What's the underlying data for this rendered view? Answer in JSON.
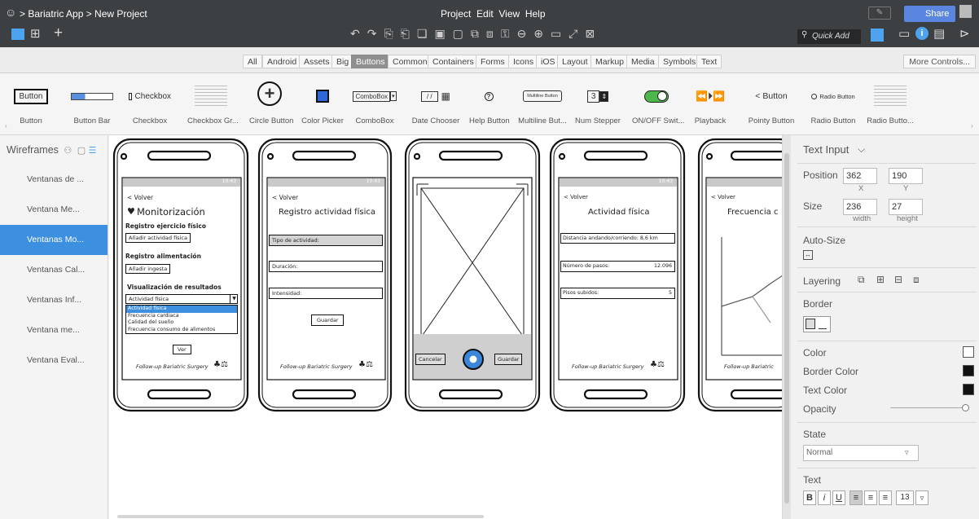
{
  "titlebar": {
    "breadcrumb": "> Bariatric App > New Project",
    "menu": "Project  Edit  View  Help",
    "share": "Share",
    "quick_add": "Quick Add"
  },
  "filters": [
    "All",
    "Android",
    "Assets",
    "Big",
    "Buttons",
    "Common",
    "Containers",
    "Forms",
    "Icons",
    "iOS",
    "Layout",
    "Markup",
    "Media",
    "Symbols",
    "Text"
  ],
  "active_filter": "Buttons",
  "more_controls": "More Controls...",
  "components": [
    {
      "label": "Button",
      "preview": "Button"
    },
    {
      "label": "Button Bar",
      "preview": ""
    },
    {
      "label": "Checkbox",
      "preview": "Checkbox"
    },
    {
      "label": "Checkbox Gr...",
      "preview": ""
    },
    {
      "label": "Circle Button",
      "preview": "+"
    },
    {
      "label": "Color Picker",
      "preview": ""
    },
    {
      "label": "ComboBox",
      "preview": "ComboBox"
    },
    {
      "label": "Date Chooser",
      "preview": "/ /"
    },
    {
      "label": "Help Button",
      "preview": "?"
    },
    {
      "label": "Multiline But...",
      "preview": "Multiline Button"
    },
    {
      "label": "Num Stepper",
      "preview": "3"
    },
    {
      "label": "ON/OFF Swit...",
      "preview": ""
    },
    {
      "label": "Playback",
      "preview": "⏪⏵⏩"
    },
    {
      "label": "Pointy Button",
      "preview": "< Button"
    },
    {
      "label": "Radio Button",
      "preview": "Radio Button"
    },
    {
      "label": "Radio Butto...",
      "preview": ""
    }
  ],
  "wireframes": {
    "title": "Wireframes",
    "items": [
      "Ventanas de ...",
      "Ventana Me...",
      "Ventanas Mo...",
      "Ventanas Cal...",
      "Ventanas Inf...",
      "Ventana me...",
      "Ventana Eval..."
    ],
    "selected_index": 2
  },
  "phones": {
    "p1": {
      "back": "< Volver",
      "time": "10:43",
      "title": "Monitorización",
      "s1": "Registro ejercicio físico",
      "b1": "Añadir actividad física",
      "s2": "Registro alimentación",
      "b2": "Añadir ingesta",
      "s3": "Visualización de resultados",
      "combo": "Actividad física",
      "options": [
        "Actividad física",
        "Frecuencia cardiaca",
        "Calidad del sueño",
        "Frecuencia consumo de alimentos"
      ],
      "ver": "Ver",
      "footer": "Follow-up Bariatric Surgery"
    },
    "p2": {
      "back": "< Volver",
      "time": "10:43",
      "title": "Registro actividad física",
      "f1": "Tipo de actividad:",
      "f2": "Duración:",
      "f3": "Intensidad:",
      "save": "Guardar",
      "footer": "Follow-up Bariatric Surgery"
    },
    "p3": {
      "cancel": "Cancelar",
      "save": "Guardar"
    },
    "p4": {
      "back": "< Volver",
      "time": "10:43",
      "title": "Actividad física",
      "r1": "Distancia andando/corriendo: 8,6 km",
      "r2l": "Número de pasos:",
      "r2v": "12.096",
      "r3l": "Pisos subidos:",
      "r3v": "5",
      "footer": "Follow-up Bariatric Surgery"
    },
    "p5": {
      "back": "< Volver",
      "title": "Frecuencia c",
      "footer": "Follow-up Bariatric"
    }
  },
  "inspector": {
    "type": "Text Input",
    "position_label": "Position",
    "x": "362",
    "y": "190",
    "x_sub": "X",
    "y_sub": "Y",
    "size_label": "Size",
    "w": "236",
    "h": "27",
    "w_sub": "width",
    "h_sub": "height",
    "autosize": "Auto-Size",
    "layering": "Layering",
    "border": "Border",
    "color": "Color",
    "border_color": "Border Color",
    "text_color": "Text Color",
    "opacity": "Opacity",
    "state": "State",
    "state_value": "Normal",
    "text": "Text",
    "font_size": "13",
    "colors": {
      "fill": "#ffffff",
      "border": "#111111",
      "text": "#111111",
      "accent": "#3d8fe0"
    }
  }
}
